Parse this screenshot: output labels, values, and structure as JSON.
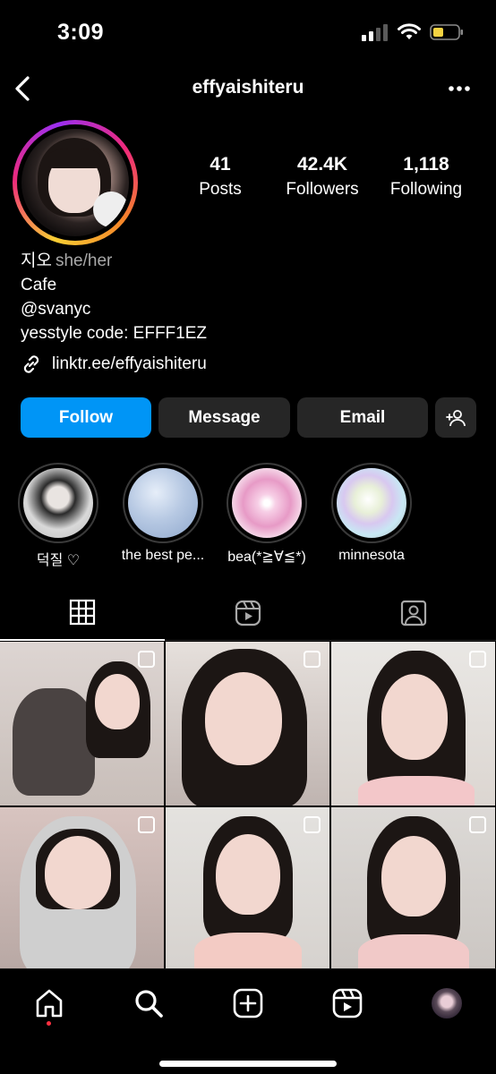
{
  "status_bar": {
    "time": "3:09"
  },
  "header": {
    "username": "effyaishiteru"
  },
  "stats": [
    {
      "value": "41",
      "label": "Posts"
    },
    {
      "value": "42.4K",
      "label": "Followers"
    },
    {
      "value": "1,118",
      "label": "Following"
    }
  ],
  "bio": {
    "name": "지오",
    "pronouns": "she/her",
    "category": "Cafe",
    "mention": "@svanyc",
    "line": "yesstyle code: EFFF1EZ",
    "link": "linktr.ee/effyaishiteru"
  },
  "buttons": {
    "follow": "Follow",
    "message": "Message",
    "email": "Email"
  },
  "highlights": [
    {
      "label": "덕질 ♡"
    },
    {
      "label": "the best pe..."
    },
    {
      "label": "bea(*≧∀≦*)"
    },
    {
      "label": "minnesota"
    }
  ],
  "tabs": [
    "grid",
    "reels",
    "tagged"
  ],
  "colors": {
    "accent": "#0095f6",
    "button_bg": "#262626",
    "notification_dot": "#ff3040",
    "battery": "#f5d342"
  }
}
